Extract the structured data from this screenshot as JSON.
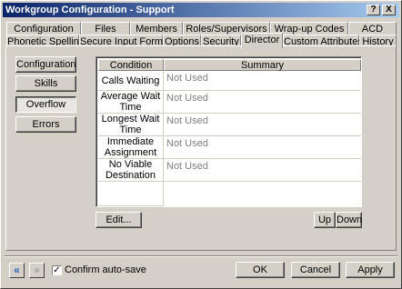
{
  "window": {
    "title": "Workgroup Configuration - Support",
    "help_label": "?",
    "close_label": "X"
  },
  "tabs": {
    "row1": [
      "Configuration",
      "Files",
      "Members",
      "Roles/Supervisors",
      "Wrap-up Codes",
      "ACD"
    ],
    "row2": [
      "Phonetic Spellings",
      "Secure Input Forms",
      "Options",
      "Security",
      "Director",
      "Custom Attributes",
      "History"
    ],
    "active": "Director"
  },
  "sidebar": {
    "items": [
      "Configuration",
      "Skills",
      "Overflow",
      "Errors"
    ],
    "selected": "Overflow"
  },
  "grid": {
    "columns": [
      "Condition",
      "Summary"
    ],
    "rows": [
      {
        "condition": "Calls Waiting",
        "summary": "Not Used"
      },
      {
        "condition": "Average Wait Time",
        "summary": "Not Used"
      },
      {
        "condition": "Longest Wait Time",
        "summary": "Not Used"
      },
      {
        "condition": "Immediate Assignment",
        "summary": "Not Used"
      },
      {
        "condition": "No Viable Destination",
        "summary": "Not Used"
      }
    ]
  },
  "buttons": {
    "edit": "Edit...",
    "up": "Up",
    "down": "Down",
    "ok": "OK",
    "cancel": "Cancel",
    "apply": "Apply"
  },
  "footer": {
    "confirm_label": "Confirm auto-save",
    "confirm_checked": true,
    "check_mark": "✓",
    "back_glyph": "«",
    "forward_glyph": "»"
  },
  "colors": {
    "title_start": "#0a246a",
    "title_end": "#a6caf0",
    "face": "#d4d0c8",
    "nav_blue": "#1f5fbf"
  }
}
